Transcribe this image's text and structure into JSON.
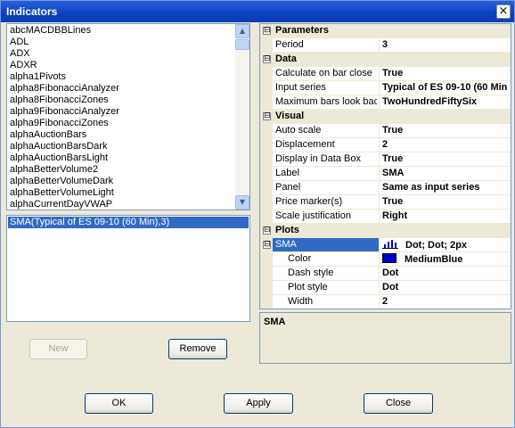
{
  "window": {
    "title": "Indicators",
    "close_glyph": "×"
  },
  "indicator_list": {
    "items": [
      "abcMACDBBLines",
      "ADL",
      "ADX",
      "ADXR",
      "alpha1Pivots",
      "alpha8FibonacciAnalyzer",
      "alpha8FibonacciZones",
      "alpha9FibonacciAnalyzer",
      "alpha9FibonacciZones",
      "alphaAuctionBars",
      "alphaAuctionBarsDark",
      "alphaAuctionBarsLight",
      "alphaBetterVolume2",
      "alphaBetterVolumeDark",
      "alphaBetterVolumeLight",
      "alphaCurrentDayVWAP"
    ],
    "scroll_up": "▲",
    "scroll_down": "▼"
  },
  "applied_list": {
    "items": [
      "SMA(Typical of ES 09-10 (60 Min),3)"
    ]
  },
  "buttons": {
    "new": "New",
    "remove": "Remove",
    "ok": "OK",
    "apply": "Apply",
    "close": "Close"
  },
  "grid": {
    "collapse_glyph": "⊟",
    "categories": {
      "parameters": "Parameters",
      "data": "Data",
      "visual": "Visual",
      "plots": "Plots"
    },
    "parameters": [
      {
        "name": "Period",
        "value": "3"
      }
    ],
    "data": [
      {
        "name": "Calculate on bar close",
        "value": "True"
      },
      {
        "name": "Input series",
        "value": "Typical of ES 09-10 (60 Min"
      },
      {
        "name": "Maximum bars look back",
        "value": "TwoHundredFiftySix"
      }
    ],
    "visual": [
      {
        "name": "Auto scale",
        "value": "True"
      },
      {
        "name": "Displacement",
        "value": "2"
      },
      {
        "name": "Display in Data Box",
        "value": "True"
      },
      {
        "name": "Label",
        "value": "SMA"
      },
      {
        "name": "Panel",
        "value": "Same as input series"
      },
      {
        "name": "Price marker(s)",
        "value": "True"
      },
      {
        "name": "Scale justification",
        "value": "Right"
      }
    ],
    "plots": {
      "sma": {
        "name": "SMA",
        "value": "Dot; Dot; 2px"
      },
      "children": [
        {
          "name": "Color",
          "value": "MediumBlue",
          "color": "#0000cd"
        },
        {
          "name": "Dash style",
          "value": "Dot"
        },
        {
          "name": "Plot style",
          "value": "Dot"
        },
        {
          "name": "Width",
          "value": "2"
        }
      ]
    }
  },
  "description": {
    "title": "SMA"
  }
}
